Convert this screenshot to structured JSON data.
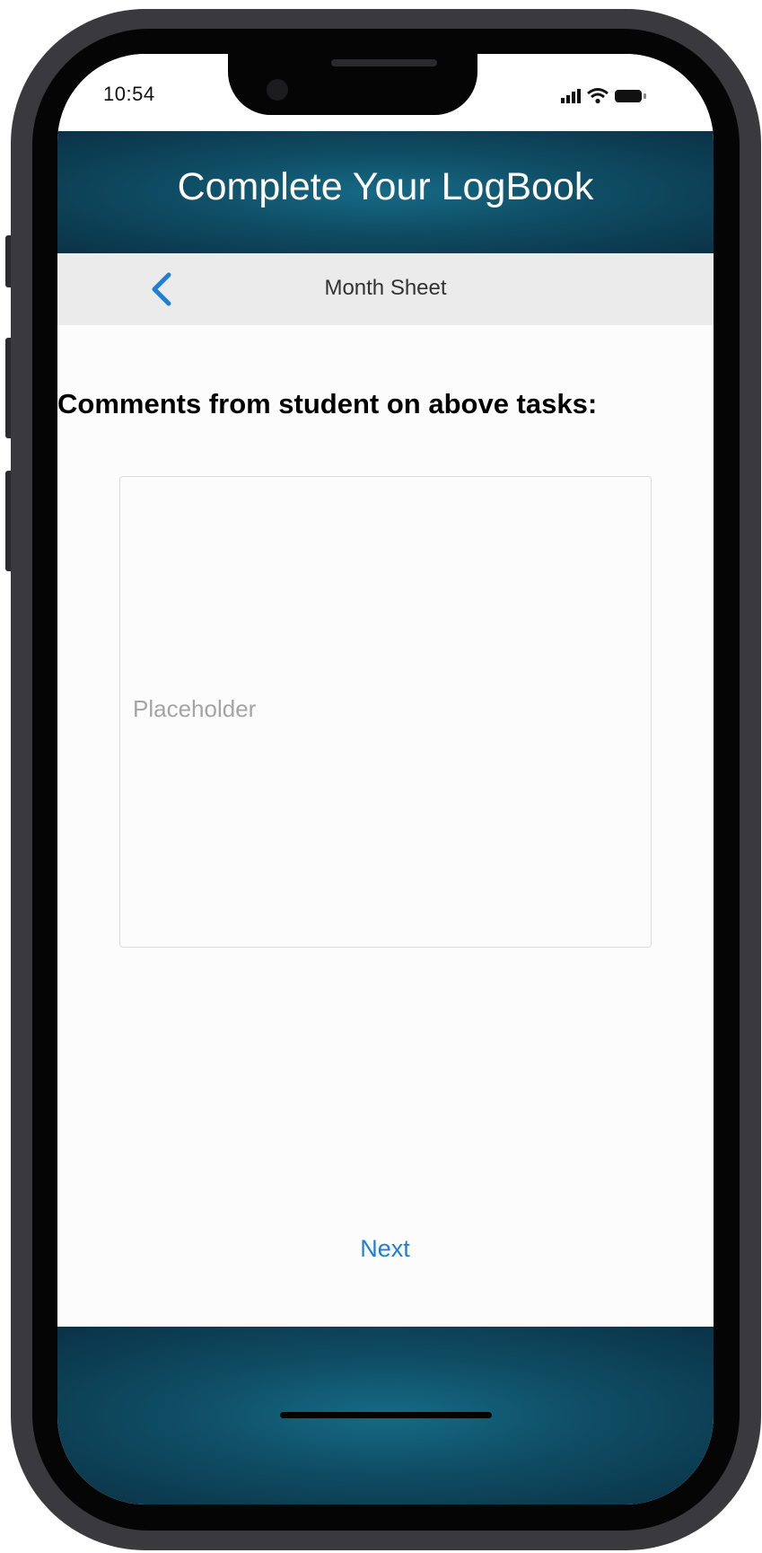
{
  "status_bar": {
    "time": "10:54",
    "icons": [
      "signal-icon",
      "wifi-icon",
      "battery-icon"
    ]
  },
  "header": {
    "title": "Complete Your LogBook"
  },
  "navbar": {
    "back_icon": "chevron-left-icon",
    "title": "Month Sheet"
  },
  "content": {
    "heading": "Comments from student on above tasks:",
    "comment_field": {
      "value": "",
      "placeholder": "Placeholder"
    },
    "next_label": "Next"
  },
  "colors": {
    "header_gradient_center": "#166a86",
    "header_gradient_edge": "#0a3246",
    "navbar_background": "#ebebeb",
    "accent_blue": "#1f7fd6",
    "placeholder_gray": "#a5a5a5"
  }
}
